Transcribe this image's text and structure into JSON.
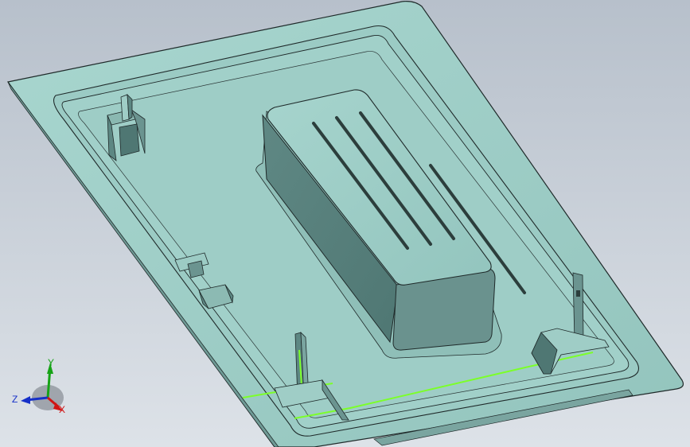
{
  "viewport": {
    "background_top": "#b9c1cc",
    "background_bottom": "#d9dee4",
    "part_color": "#9fcdc6",
    "part_shadow": "#6f9a95",
    "edge_color": "#1f2a2a",
    "highlight_edge_color": "#7cff2a"
  },
  "triad": {
    "x_label": "X",
    "y_label": "Y",
    "z_label": "Z",
    "x_color": "#d01515",
    "y_color": "#16a316",
    "z_color": "#1630c8"
  }
}
